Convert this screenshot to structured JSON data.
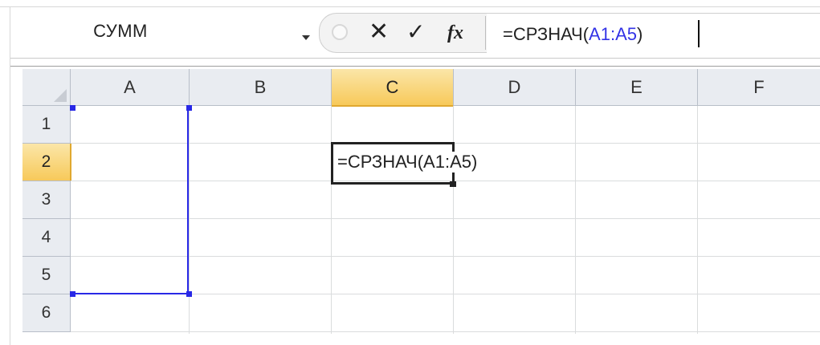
{
  "formula_bar": {
    "name_box": "СУММ",
    "formula_prefix": "=СРЗНАЧ(",
    "formula_ref": "A1:A5",
    "formula_suffix": ")"
  },
  "grid": {
    "columns": [
      "A",
      "B",
      "C",
      "D",
      "E",
      "F"
    ],
    "rows": [
      "1",
      "2",
      "3",
      "4",
      "5",
      "6"
    ],
    "active_column": "C",
    "active_row": "2",
    "active_cell_text": "=СРЗНАЧ(A1:A5)",
    "referenced_range": "A1:A5"
  },
  "colors": {
    "range_reference": "#2828e6",
    "header_highlight": "#f7c95a"
  }
}
